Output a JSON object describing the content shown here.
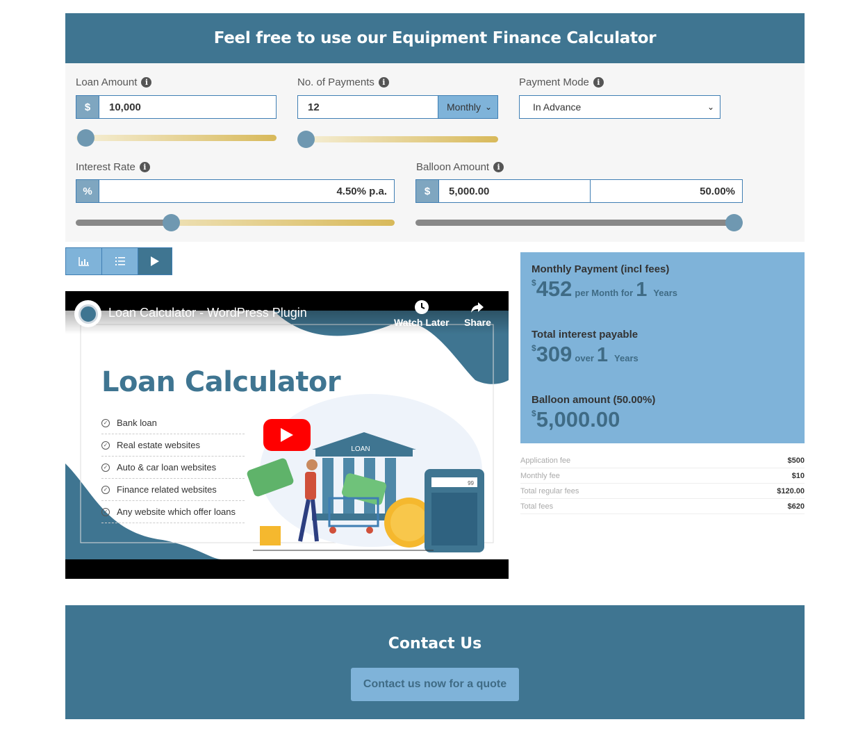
{
  "header": {
    "title": "Feel free to use our Equipment Finance Calculator"
  },
  "form": {
    "loan_amount": {
      "label": "Loan Amount",
      "currency": "$",
      "value": "10,000",
      "slider_fraction": 0.03
    },
    "payments": {
      "label": "No. of Payments",
      "value": "12",
      "frequency": "Monthly",
      "slider_fraction": 0.03
    },
    "payment_mode": {
      "label": "Payment Mode",
      "value": "In Advance"
    },
    "interest_rate": {
      "label": "Interest Rate",
      "addon": "%",
      "value": "4.50% p.a.",
      "slider_fraction": 0.3
    },
    "balloon": {
      "label": "Balloon Amount",
      "currency": "$",
      "value": "5,000.00",
      "percent": "50.00%",
      "slider_fraction": 1.0
    }
  },
  "tabs": [
    {
      "name": "chart-icon"
    },
    {
      "name": "list-icon"
    },
    {
      "name": "play-icon"
    }
  ],
  "video": {
    "title": "Loan Calculator - WordPress Plugin",
    "watch_later": "Watch Later",
    "share": "Share",
    "thumb_title": "Loan Calculator",
    "features": [
      "Bank loan",
      "Real estate websites",
      "Auto & car loan websites",
      "Finance related websites",
      "Any website which offer loans"
    ],
    "bank_sign": "LOAN",
    "calc_display": "99"
  },
  "results": {
    "monthly": {
      "label": "Monthly Payment (incl fees)",
      "currency": "$",
      "amount": "452",
      "per": "per Month for",
      "years_num": "1",
      "years": "Years"
    },
    "interest": {
      "label": "Total interest payable",
      "currency": "$",
      "amount": "309",
      "over": "over",
      "years_num": "1",
      "years": "Years"
    },
    "balloon": {
      "label": "Balloon amount (50.00%)",
      "currency": "$",
      "amount": "5,000.00"
    }
  },
  "fees": [
    {
      "label": "Application fee",
      "value": "$500"
    },
    {
      "label": "Monthly fee",
      "value": "$10"
    },
    {
      "label": "Total regular fees",
      "value": "$120.00"
    },
    {
      "label": "Total fees",
      "value": "$620"
    }
  ],
  "contact": {
    "title": "Contact Us",
    "button": "Contact us now for a quote"
  },
  "colors": {
    "brand": "#3f7591",
    "accent": "#7fb3d9",
    "slider_gold": "#d8b95a",
    "youtube_red": "#ff0000"
  }
}
